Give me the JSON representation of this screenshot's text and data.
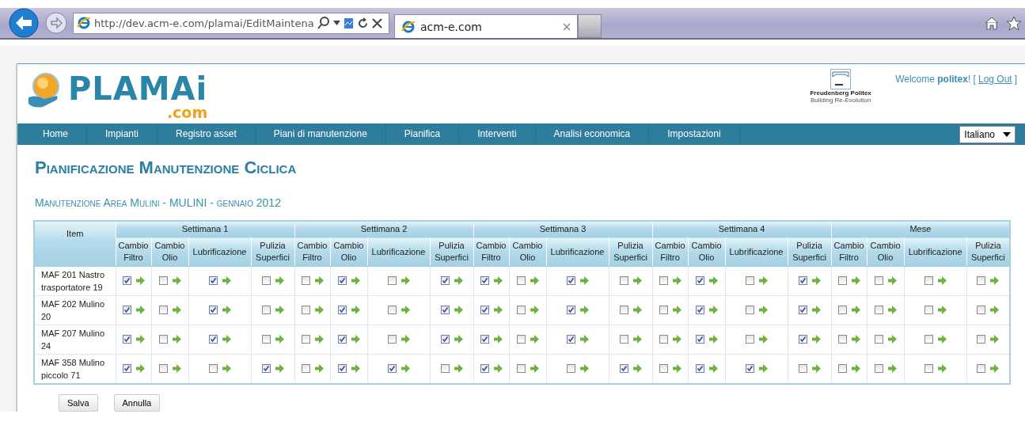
{
  "browser": {
    "address": "http://dev.acm-e.com/plamai/EditMaintena",
    "tab": "acm-e.com"
  },
  "header": {
    "logo": "PLAMAi",
    "logo_suffix": ".com",
    "partner": "Freudenberg Politex",
    "partner_tagline": "Building Re-Evolution",
    "welcome": "Welcome **politex**! [",
    "logout": "Log Out",
    "welcome_end": "]"
  },
  "nav": {
    "items": [
      "Home",
      "Impianti",
      "Registro asset",
      "Piani di manutenzione",
      "Pianifica",
      "Interventi",
      "Analisi economica",
      "Impostazioni"
    ],
    "language": "Italiano"
  },
  "title": "Pianificazione Manutenzione Ciclica",
  "subtitle": "Manutenzione Area Mulini - MULINI - gennaio 2012",
  "table": {
    "item_header": "Item",
    "groups": [
      {
        "label": "Settimana 1",
        "columns": [
          "Cambio Filtro",
          "Cambio Olio",
          "Lubrificazione",
          "Pulizia Superfici"
        ]
      },
      {
        "label": "Settimana 2",
        "columns": [
          "Cambio Filtro",
          "Cambio Olio",
          "Lubrificazione",
          "Pulizia Superfici"
        ]
      },
      {
        "label": "Settimana 3",
        "columns": [
          "Cambio Filtro",
          "Cambio Olio",
          "Lubrificazione",
          "Pulizia Superfici"
        ]
      },
      {
        "label": "Settimana 4",
        "columns": [
          "Cambio Filtro",
          "Cambio Olio",
          "Lubrificazione",
          "Pulizia Superfici"
        ]
      },
      {
        "label": "Mese",
        "columns": [
          "Cambio Filtro",
          "Cambio Olio",
          "Lubrificazione",
          "Pulizia Superfici"
        ]
      }
    ],
    "rows": [
      {
        "item": "MAF 201 Nastro trasportatore 19",
        "cells": [
          {
            "checked": true
          },
          {
            "checked": false
          },
          {
            "checked": true
          },
          {
            "checked": false
          },
          {
            "checked": false
          },
          {
            "checked": true
          },
          {
            "checked": false
          },
          {
            "checked": true
          },
          {
            "checked": true
          },
          {
            "checked": false
          },
          {
            "checked": true
          },
          {
            "checked": false
          },
          {
            "checked": false
          },
          {
            "checked": true
          },
          {
            "checked": false
          },
          {
            "checked": true
          },
          {
            "checked": false
          },
          {
            "checked": false
          },
          {
            "checked": false
          },
          {
            "checked": false
          }
        ]
      },
      {
        "item": "MAF 202 Mulino 20",
        "cells": [
          {
            "checked": true
          },
          {
            "checked": false
          },
          {
            "checked": true
          },
          {
            "checked": false
          },
          {
            "checked": false
          },
          {
            "checked": true
          },
          {
            "checked": false
          },
          {
            "checked": true
          },
          {
            "checked": true
          },
          {
            "checked": false
          },
          {
            "checked": true
          },
          {
            "checked": false
          },
          {
            "checked": false
          },
          {
            "checked": true
          },
          {
            "checked": false
          },
          {
            "checked": true
          },
          {
            "checked": false
          },
          {
            "checked": false
          },
          {
            "checked": false
          },
          {
            "checked": false
          }
        ]
      },
      {
        "item": "MAF 207 Mulino 24",
        "cells": [
          {
            "checked": true
          },
          {
            "checked": false
          },
          {
            "checked": true
          },
          {
            "checked": false
          },
          {
            "checked": false
          },
          {
            "checked": true
          },
          {
            "checked": false
          },
          {
            "checked": true
          },
          {
            "checked": true
          },
          {
            "checked": false
          },
          {
            "checked": true
          },
          {
            "checked": false
          },
          {
            "checked": false
          },
          {
            "checked": true
          },
          {
            "checked": false
          },
          {
            "checked": true
          },
          {
            "checked": false
          },
          {
            "checked": false
          },
          {
            "checked": false
          },
          {
            "checked": false
          }
        ]
      },
      {
        "item": "MAF 358 Mulino piccolo 71",
        "cells": [
          {
            "checked": true
          },
          {
            "checked": false
          },
          {
            "checked": false
          },
          {
            "checked": true
          },
          {
            "checked": false
          },
          {
            "checked": true
          },
          {
            "checked": true
          },
          {
            "checked": false
          },
          {
            "checked": true
          },
          {
            "checked": false
          },
          {
            "checked": false
          },
          {
            "checked": true
          },
          {
            "checked": false
          },
          {
            "checked": true
          },
          {
            "checked": true
          },
          {
            "checked": false
          },
          {
            "checked": false
          },
          {
            "checked": false
          },
          {
            "checked": false
          },
          {
            "checked": false
          }
        ]
      }
    ]
  },
  "buttons": [
    "Salva",
    "Annulla"
  ]
}
